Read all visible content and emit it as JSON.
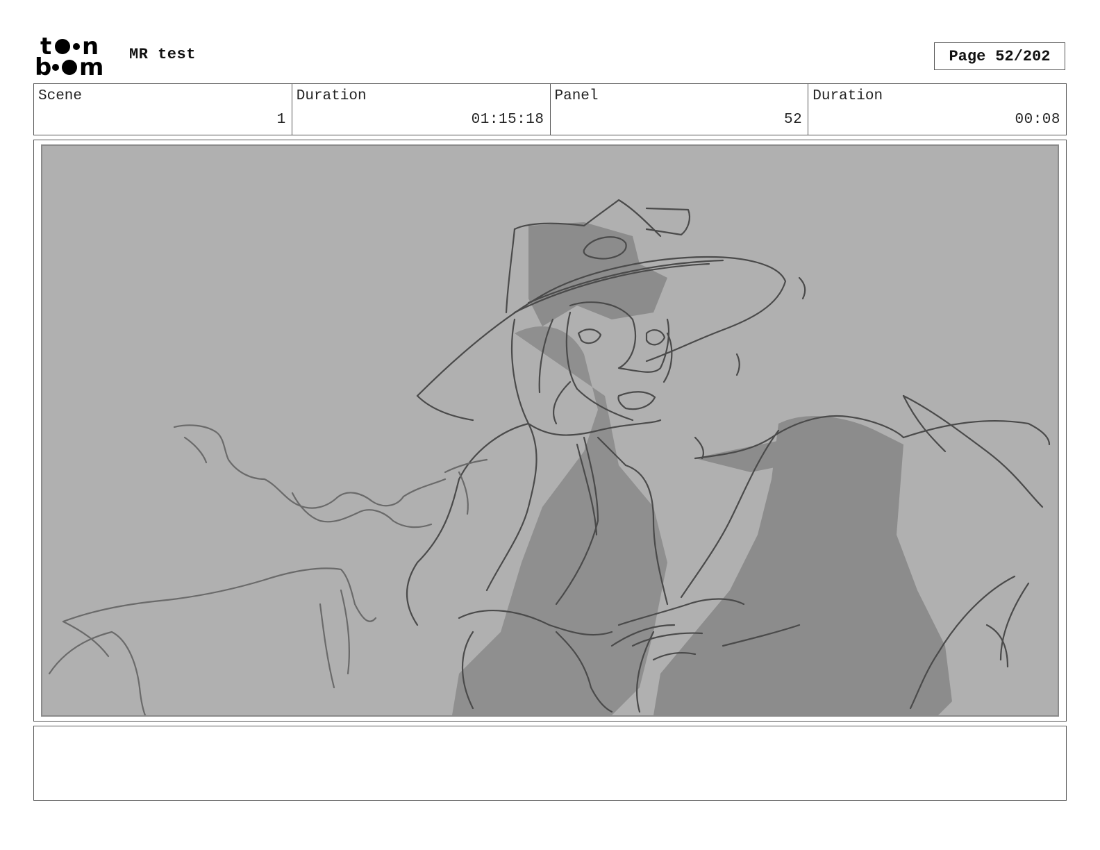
{
  "header": {
    "logo_text": "toon boom",
    "project_title": "MR test",
    "page_label": "Page",
    "page_number": "52/202"
  },
  "info": {
    "scene_label": "Scene",
    "scene_value": "1",
    "scene_duration_label": "Duration",
    "scene_duration_value": "01:15:18",
    "panel_label": "Panel",
    "panel_value": "52",
    "panel_duration_label": "Duration",
    "panel_duration_value": "00:08"
  },
  "panel": {
    "background_color": "#b0b0b0",
    "shadow_color": "#8a8a8a",
    "line_color": "#4a4a4a"
  },
  "notes": {
    "text": ""
  }
}
